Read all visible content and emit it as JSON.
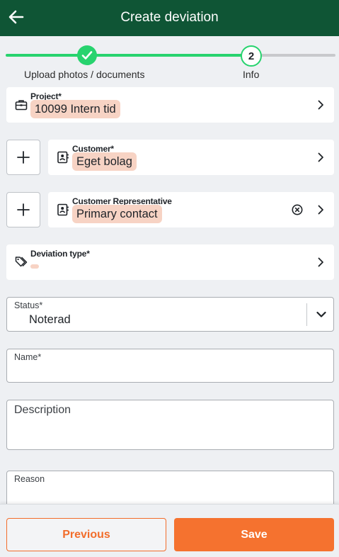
{
  "colors": {
    "header_bg": "#0f5535",
    "progress_green": "#27d36e",
    "chip_bg": "#f7d3c4",
    "accent_orange": "#f5722f"
  },
  "header": {
    "title": "Create deviation",
    "back_icon": "arrow-left-icon"
  },
  "stepper": {
    "steps": [
      {
        "label": "Upload photos / documents",
        "state": "completed",
        "icon": "check-icon"
      },
      {
        "label": "Info",
        "number": "2",
        "state": "current"
      }
    ]
  },
  "form": {
    "project": {
      "label": "Project*",
      "value": "10099 Intern tid",
      "icon": "briefcase-icon"
    },
    "customer": {
      "label": "Customer*",
      "value": "Eget bolag",
      "icon": "contact-card-icon"
    },
    "customer_representative": {
      "label": "Customer Representative",
      "value": "Primary contact",
      "icon": "contact-card-icon"
    },
    "deviation_type": {
      "label": "Deviation type*",
      "value": "",
      "icon": "tags-icon"
    },
    "status": {
      "label": "Status*",
      "value": "Noterad"
    },
    "name": {
      "label": "Name*",
      "value": ""
    },
    "description": {
      "placeholder": "Description",
      "value": ""
    },
    "reason": {
      "label": "Reason",
      "value": ""
    }
  },
  "footer": {
    "previous_label": "Previous",
    "save_label": "Save"
  }
}
